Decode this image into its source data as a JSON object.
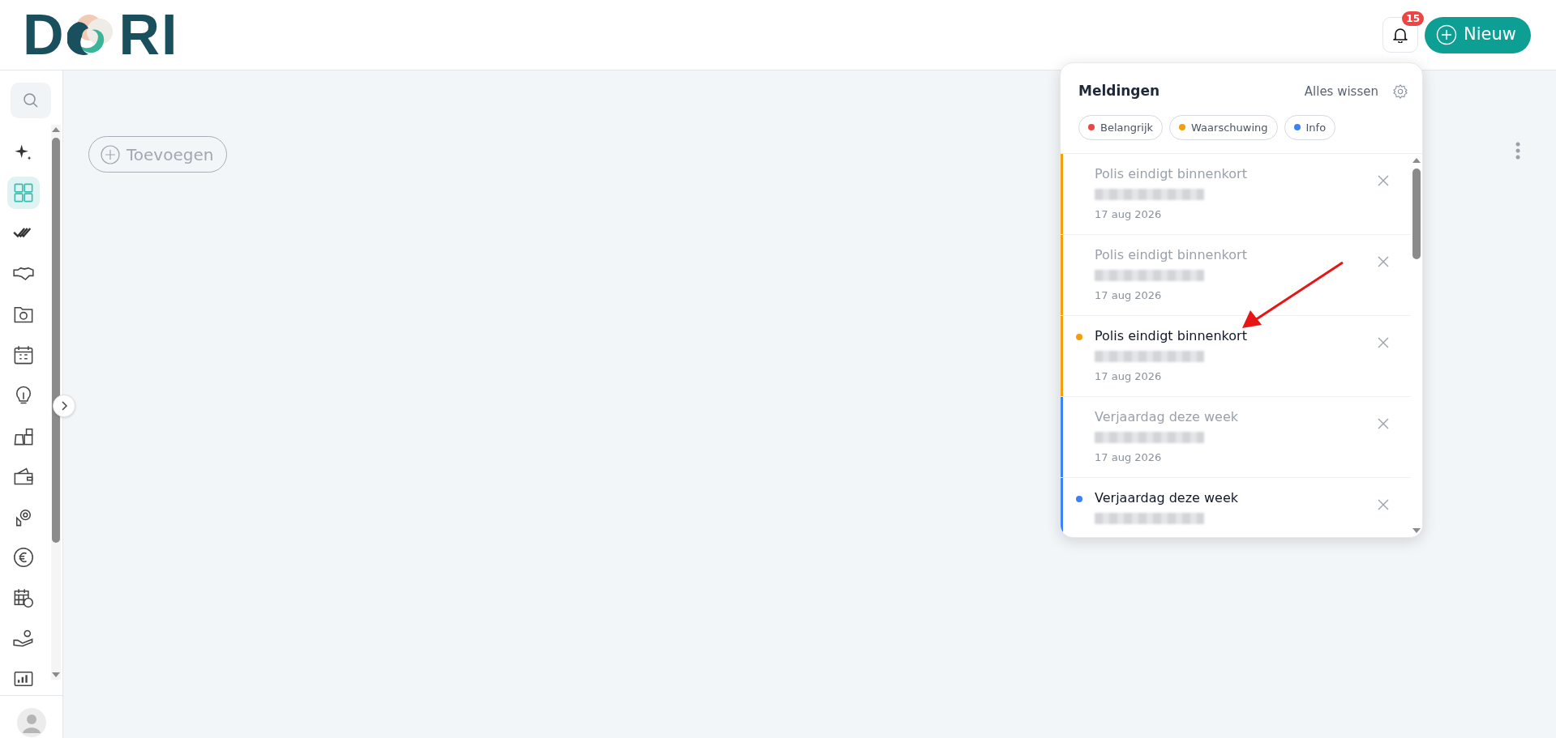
{
  "brand": {
    "name_start": "D",
    "name_end": "RI"
  },
  "header": {
    "notification_count": "15",
    "new_button": "Nieuw"
  },
  "sidebar": {
    "items": [
      {
        "selected": false
      },
      {
        "selected": true
      },
      {
        "selected": false
      },
      {
        "selected": false
      },
      {
        "selected": false
      },
      {
        "selected": false
      },
      {
        "selected": false
      },
      {
        "selected": false
      },
      {
        "selected": false
      },
      {
        "selected": false
      },
      {
        "selected": false
      },
      {
        "selected": false
      },
      {
        "selected": false
      },
      {
        "selected": false
      }
    ]
  },
  "main": {
    "add_button": "Toevoegen"
  },
  "notifications": {
    "title": "Meldingen",
    "clear_all": "Alles wissen",
    "filters": [
      {
        "label": "Belangrijk",
        "color": "#ef4444"
      },
      {
        "label": "Waarschuwing",
        "color": "#f59e0b"
      },
      {
        "label": "Info",
        "color": "#3b82f6"
      }
    ],
    "items": [
      {
        "title": "Polis eindigt binnenkort",
        "date": "17 aug 2026",
        "color": "#f59e0b",
        "unread": false
      },
      {
        "title": "Polis eindigt binnenkort",
        "date": "17 aug 2026",
        "color": "#f59e0b",
        "unread": false
      },
      {
        "title": "Polis eindigt binnenkort",
        "date": "17 aug 2026",
        "color": "#f59e0b",
        "unread": true
      },
      {
        "title": "Verjaardag deze week",
        "date": "17 aug 2026",
        "color": "#3b82f6",
        "unread": false
      },
      {
        "title": "Verjaardag deze week",
        "color": "#3b82f6",
        "unread": true
      }
    ]
  }
}
